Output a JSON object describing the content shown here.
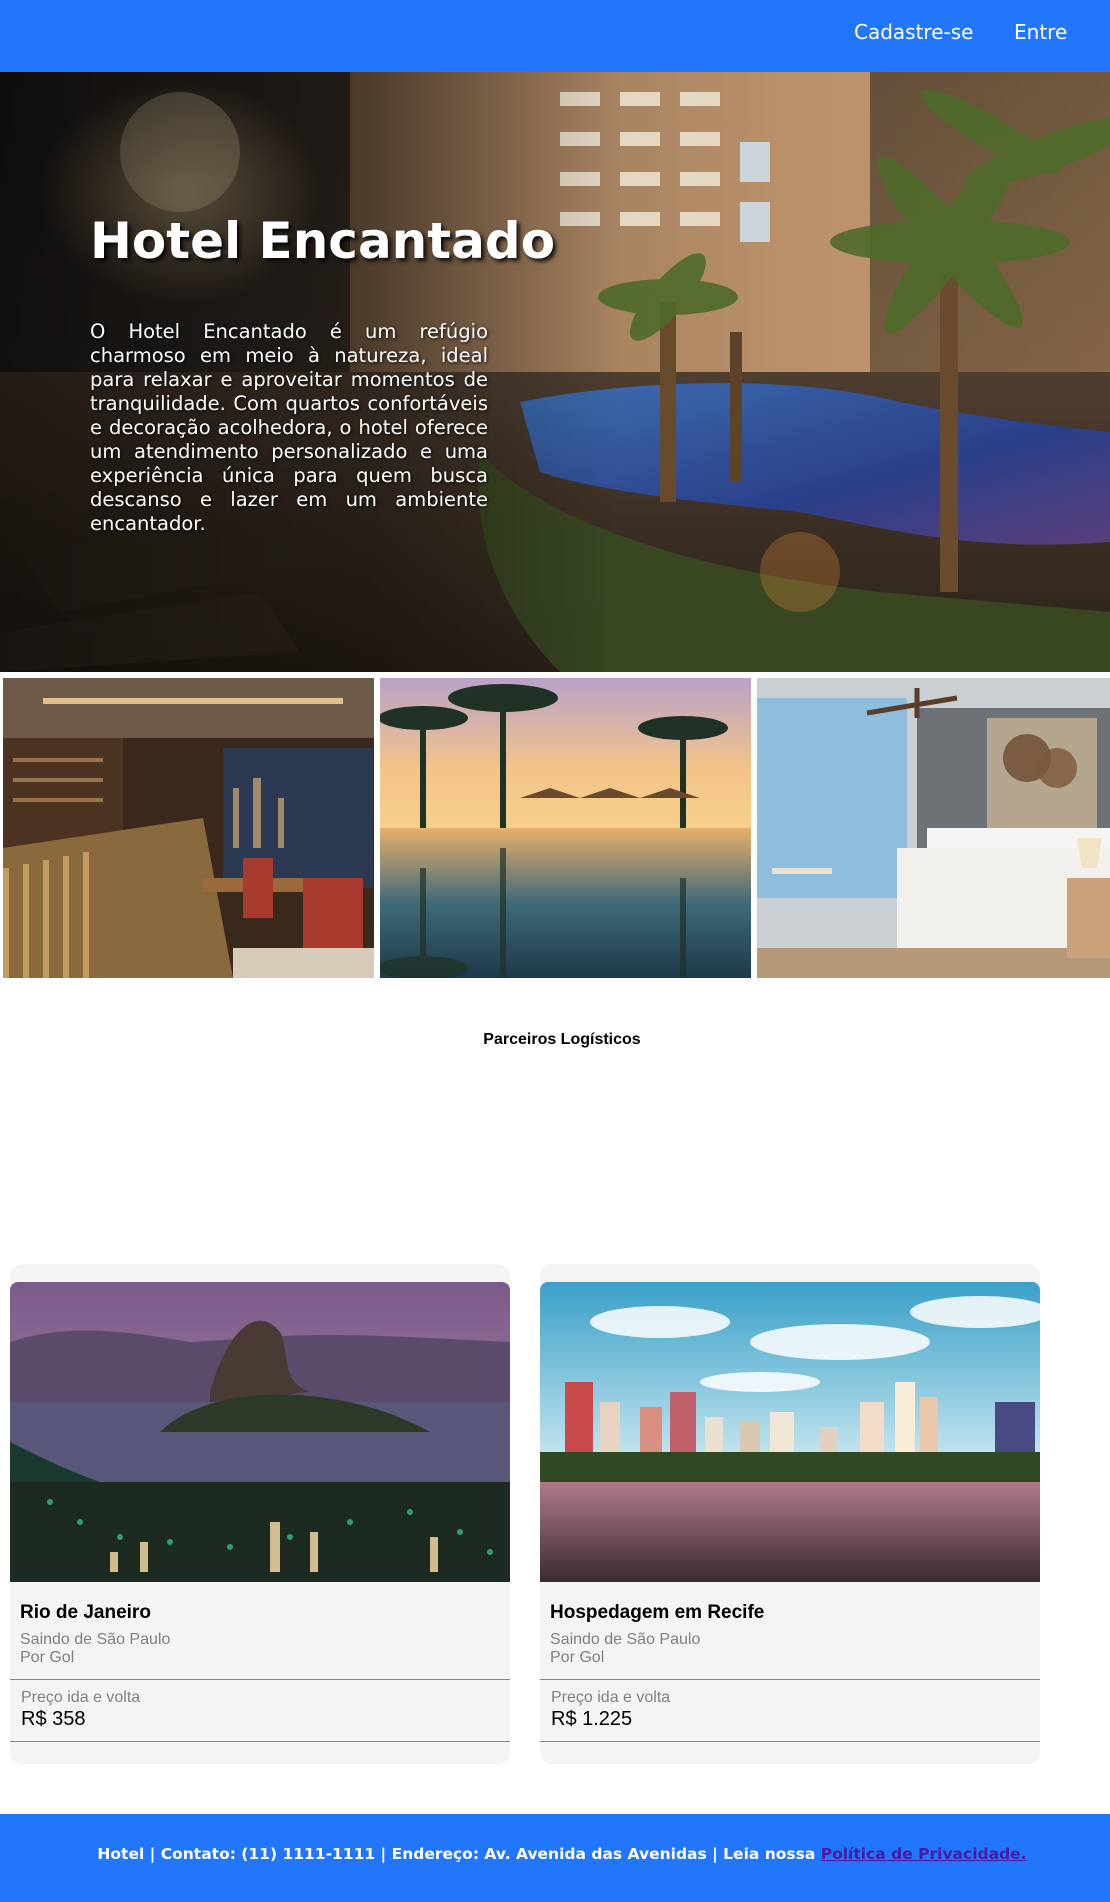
{
  "header": {
    "signup_label": "Cadastre-se",
    "login_label": "Entre"
  },
  "hero": {
    "title": "Hotel Encantado",
    "description": "O Hotel Encantado é um refúgio charmoso em meio à natureza, ideal para relaxar e aproveitar momentos de tranquilidade. Com quartos confortáveis e decoração acolhedora, o hotel oferece um atendimento personalizado e uma experiência única para quem busca descanso e lazer em um ambiente encantador."
  },
  "gallery": [
    {
      "subject": "restaurant"
    },
    {
      "subject": "pool-with-palms-at-sunset"
    },
    {
      "subject": "bedroom"
    }
  ],
  "partners": {
    "title": "Parceiros Logísticos"
  },
  "cards": [
    {
      "title": "Rio de Janeiro",
      "origin": "Saindo de São Paulo",
      "airline": "Por Gol",
      "price_label": "Preço ida e volta",
      "price": "R$ 358"
    },
    {
      "title": "Hospedagem em Recife",
      "origin": "Saindo de São Paulo",
      "airline": "Por Gol",
      "price_label": "Preço ida e volta",
      "price": "R$ 1.225"
    }
  ],
  "footer": {
    "text": "Hotel | Contato: (11) 1111-1111 | Endereço: Av. Avenida das Avenidas | Leia nossa ",
    "link_label": "Política de Privacidade."
  },
  "colors": {
    "brand_blue": "#2276fb",
    "card_bg": "#f4f4f4",
    "footer_link": "#4b1aa3"
  }
}
